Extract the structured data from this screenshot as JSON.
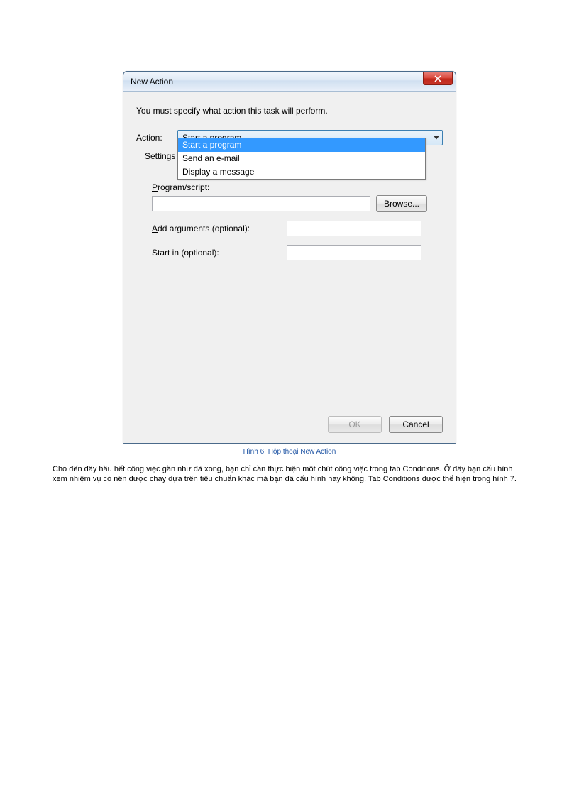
{
  "dialog": {
    "title": "New Action",
    "instruction": "You must specify what action this task will perform.",
    "action_label": "Action:",
    "combo_value": "Start a program",
    "dropdown": {
      "item0": "Start a program",
      "item1": "Send an e-mail",
      "item2": "Display a message"
    },
    "settings_label": "Settings",
    "program_label_prefix": "P",
    "program_label_rest": "rogram/script:",
    "browse_label": "Browse...",
    "addargs_prefix": "A",
    "addargs_rest": "dd arguments (optional):",
    "startin_label": "Start in (optional):",
    "ok_label": "OK",
    "cancel_label": "Cancel"
  },
  "caption": "Hình 6: Hộp thoại New Action",
  "body_text": "Cho đến đây hầu hết công việc gần như đã xong, bạn chỉ cần thực hiện một chút công việc trong tab Conditions. Ở đây bạn cấu hình xem nhiệm vụ có nên được chạy dựa trên tiêu chuẩn khác mà bạn đã cấu hình hay không. Tab Conditions được thể hiện trong hình 7."
}
